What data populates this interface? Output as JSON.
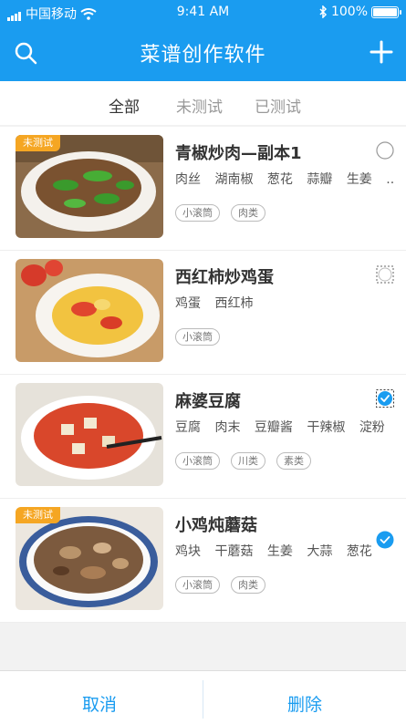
{
  "status": {
    "carrier": "中国移动",
    "time": "9:41 AM",
    "battery": "100%"
  },
  "nav": {
    "title": "菜谱创作软件"
  },
  "tabs": [
    {
      "label": "全部",
      "active": true
    },
    {
      "label": "未测试",
      "active": false
    },
    {
      "label": "已测试",
      "active": false
    }
  ],
  "recipes": [
    {
      "name": "青椒炒肉—副本1",
      "badge": "未测试",
      "ingredients": [
        "肉丝",
        "湖南椒",
        "葱花",
        "蒜瓣",
        "生姜",
        "..."
      ],
      "tags": [
        "小滚筒",
        "肉类"
      ],
      "selection": "unchecked"
    },
    {
      "name": "西红柿炒鸡蛋",
      "badge": "",
      "ingredients": [
        "鸡蛋",
        "西红柿"
      ],
      "tags": [
        "小滚筒"
      ],
      "selection": "dashed"
    },
    {
      "name": "麻婆豆腐",
      "badge": "",
      "ingredients": [
        "豆腐",
        "肉末",
        "豆瓣酱",
        "干辣椒",
        "淀粉"
      ],
      "tags": [
        "小滚筒",
        "川类",
        "素类"
      ],
      "selection": "checked-square"
    },
    {
      "name": "小鸡炖蘑菇",
      "badge": "未测试",
      "ingredients": [
        "鸡块",
        "干蘑菇",
        "生姜",
        "大蒜",
        "葱花"
      ],
      "tags": [
        "小滚筒",
        "肉类"
      ],
      "selection": "checked"
    }
  ],
  "footer": {
    "cancel": "取消",
    "delete": "删除"
  },
  "colors": {
    "primary": "#1a9cf0",
    "badge": "#f5a623"
  }
}
